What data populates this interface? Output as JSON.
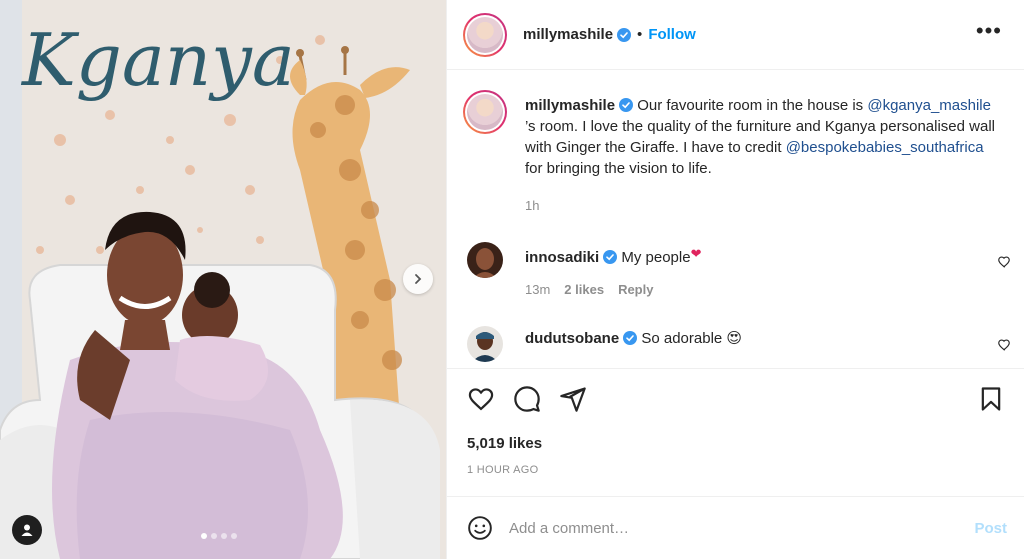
{
  "media": {
    "wall_text": "Kganya",
    "carousel_dots": [
      true,
      false,
      false,
      false
    ]
  },
  "header": {
    "username": "millymashile",
    "separator": "•",
    "follow_label": "Follow",
    "more_label": "•••"
  },
  "caption": {
    "username": "millymashile",
    "text_1": "Our favourite room in the house is",
    "mention_1": "@kganya_mashile",
    "text_2": " ’s room. I love the quality of the furniture and Kganya personalised wall with Ginger the Giraffe. I have to credit ",
    "mention_2": "@bespokebabies_southafrica",
    "text_3": " for bringing the vision to life.",
    "time": "1h"
  },
  "comments": [
    {
      "username": "innosadiki",
      "text": "My people",
      "emoji": "❤",
      "time": "13m",
      "likes": "2 likes",
      "reply": "Reply"
    },
    {
      "username": "dudutsobane",
      "text": "So adorable",
      "emoji": "😍"
    }
  ],
  "actions": {
    "likes": "5,019 likes",
    "posted": "1 HOUR AGO"
  },
  "add_comment": {
    "placeholder": "Add a comment…",
    "post_label": "Post"
  },
  "colors": {
    "accent": "#0095f6",
    "verified": "#3897f0",
    "mention": "#1f4f8f",
    "post_disabled": "#b2dffc"
  }
}
